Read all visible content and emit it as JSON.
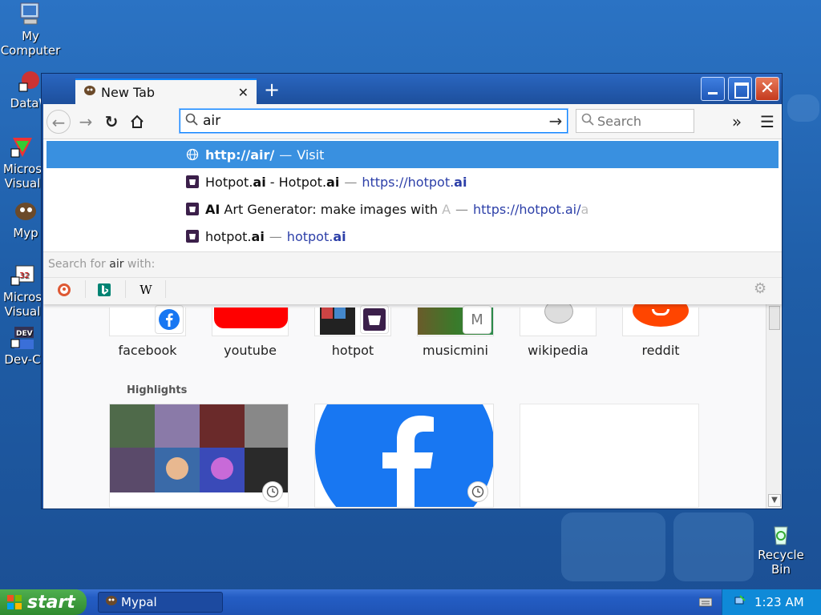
{
  "desktop": {
    "icons": [
      {
        "label": "My\nComputer"
      },
      {
        "label": "DataW"
      },
      {
        "label": "Micros\nVisual"
      },
      {
        "label": "Myp"
      },
      {
        "label": "Micros\nVisual"
      },
      {
        "label": "Dev-C"
      },
      {
        "label": "Recycle\nBin"
      }
    ]
  },
  "browser": {
    "tab": {
      "title": "New Tab",
      "close": "✕"
    },
    "new_tab": "+",
    "url_value": "air",
    "search_placeholder": "Search",
    "suggestions": [
      {
        "bold": "http://air/",
        "dash": "—",
        "rest": "Visit"
      },
      {
        "bold1": "Hotpot.",
        "ai1": "ai",
        "mid": " - Hotpot.",
        "ai2": "ai",
        "dash": "—",
        "url_a": "https://hotpot.",
        "url_b": "ai"
      },
      {
        "ai": "AI",
        "rest": " Art Generator: make images with ",
        "fade": "A",
        "dash": "—",
        "url_a": "https://hotpot.ai/",
        "fade_url": "a"
      },
      {
        "bold": "hotpot.",
        "ai": "ai",
        "dash": "—",
        "url_a": "hotpot.",
        "url_b": "ai"
      }
    ],
    "search_with": {
      "prefix": "Search for ",
      "term": "air",
      "suffix": " with:"
    },
    "engines": [
      "duckduckgo-icon",
      "bing-icon",
      "wikipedia-icon"
    ],
    "top_sites": [
      {
        "name": "facebook"
      },
      {
        "name": "youtube"
      },
      {
        "name": "hotpot"
      },
      {
        "name": "musicmini",
        "badge": "M"
      },
      {
        "name": "wikipedia"
      },
      {
        "name": "reddit"
      }
    ],
    "highlights_title": "Highlights"
  },
  "taskbar": {
    "start": "start",
    "task": "Mypal",
    "clock": "1:23 AM"
  },
  "colors": {
    "accent": "#0a84ff",
    "selected_row": "#3990e0",
    "url_text": "#2c3fa8"
  }
}
